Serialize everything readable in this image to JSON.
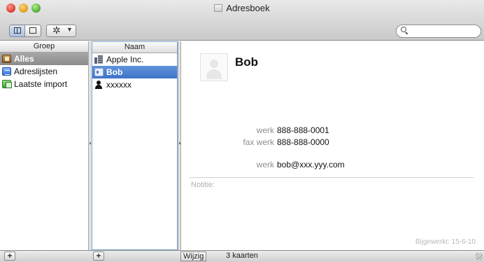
{
  "window": {
    "title": "Adresboek"
  },
  "toolbar": {
    "search": {
      "placeholder": "",
      "value": ""
    }
  },
  "groups": {
    "header": "Groep",
    "items": [
      {
        "label": "Alles",
        "icon": "address-book-icon",
        "selected": true
      },
      {
        "label": "Adreslijsten",
        "icon": "list-icon",
        "selected": false
      },
      {
        "label": "Laatste import",
        "icon": "import-icon",
        "selected": false
      }
    ]
  },
  "names": {
    "header": "Naam",
    "items": [
      {
        "label": "Apple Inc.",
        "icon": "company-icon",
        "selected": false
      },
      {
        "label": "Bob",
        "icon": "card-icon",
        "selected": true
      },
      {
        "label": "xxxxxx",
        "icon": "person-icon",
        "selected": false
      }
    ]
  },
  "detail": {
    "name": "Bob",
    "fields": [
      {
        "label": "werk",
        "value": "888-888-0001"
      },
      {
        "label": "fax werk",
        "value": "888-888-0000"
      },
      {
        "label": "werk",
        "value": "bob@xxx.yyy.com"
      }
    ],
    "note_label": "Notitie:",
    "updated": "Bijgewerkt: 15-6-10"
  },
  "bottombar": {
    "add_group": "+",
    "add_person": "+",
    "edit_label": "Wijzig",
    "count": "3 kaarten"
  },
  "colors": {
    "selection_blue": "#3f74c6",
    "selection_gray": "#8c8c8c",
    "label_gray": "#8e8e8e"
  }
}
